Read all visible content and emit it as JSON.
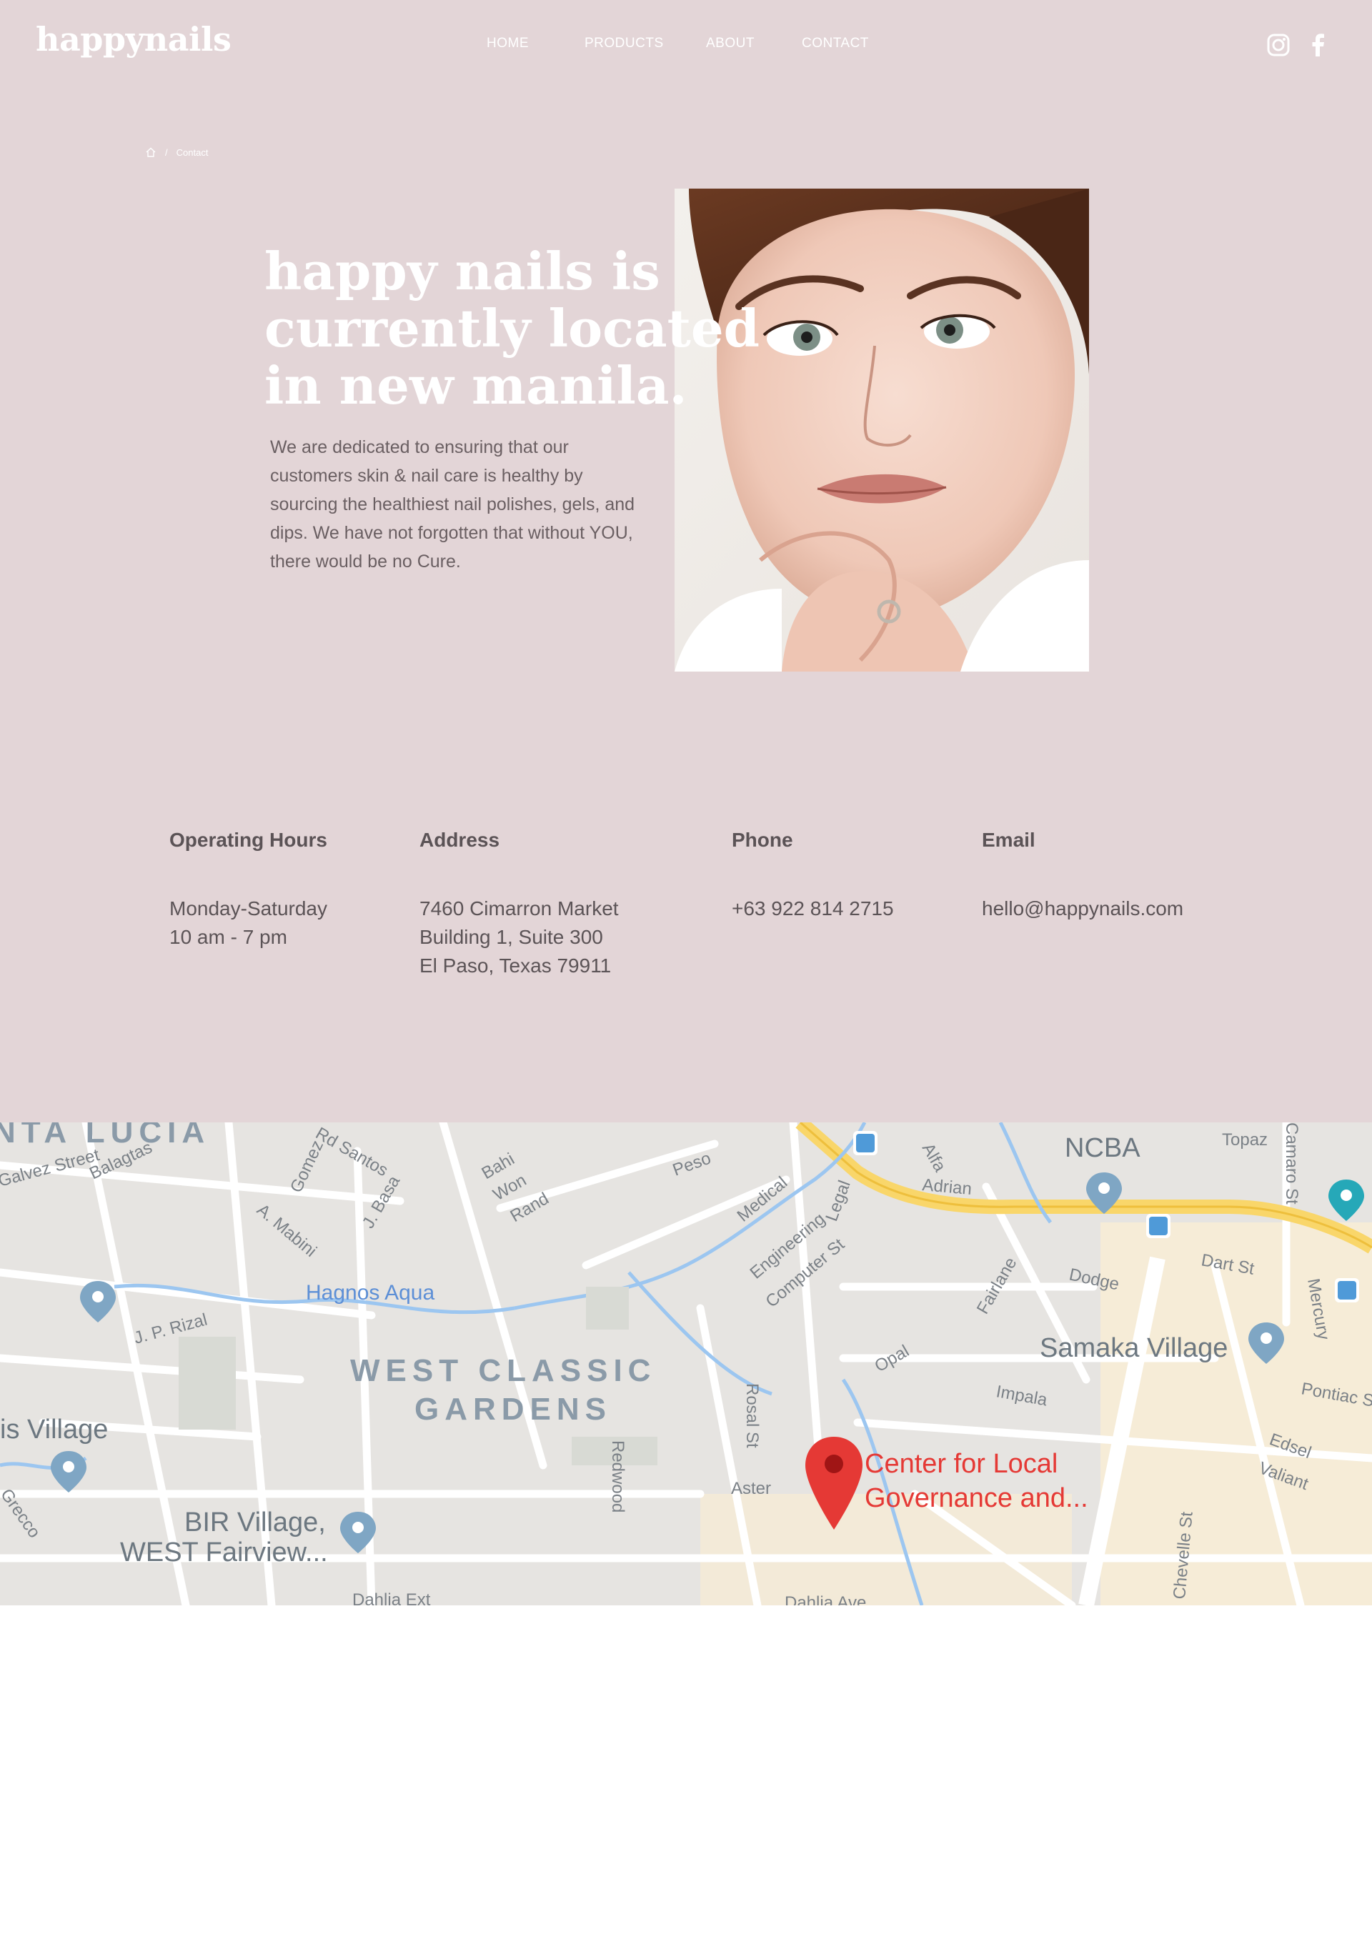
{
  "brand": {
    "logo": "happynails"
  },
  "nav": {
    "items": [
      "HOME",
      "PRODUCTS",
      "ABOUT",
      "CONTACT"
    ]
  },
  "social": {
    "icons": [
      "instagram-icon",
      "facebook-icon"
    ]
  },
  "breadcrumb": {
    "current": "Contact",
    "separator": "/"
  },
  "hero": {
    "title_lines": [
      "happy nails is",
      "currently located",
      "in new manila."
    ],
    "body": "We are dedicated to ensuring that our customers skin & nail care is healthy by sourcing the healthiest nail polishes, gels, and dips. We have not forgotten that without YOU, there would be no Cure."
  },
  "info": {
    "hours": {
      "heading": "Operating Hours",
      "lines": [
        "Monday-Saturday",
        "10 am - 7 pm"
      ]
    },
    "address": {
      "heading": "Address",
      "lines": [
        "7460 Cimarron Market",
        "Building 1, Suite 300",
        "El Paso, Texas 79911"
      ]
    },
    "phone": {
      "heading": "Phone",
      "lines": [
        "+63 922 814 2715"
      ]
    },
    "email": {
      "heading": "Email",
      "lines": [
        "hello@happynails.com"
      ]
    }
  },
  "map": {
    "pin_label_lines": [
      "Center for Local",
      "Governance and..."
    ],
    "areas": [
      "WEST CLASSIC",
      "GARDENS",
      "NTA LUCIA",
      "Samaka Village",
      "NCBA",
      "is Village",
      "BIR Village,",
      "WEST Fairview...",
      "Hagnos Aqua"
    ],
    "streets": [
      "Galvez Street",
      "Balagtas",
      "A. Mabini",
      "J. Basa",
      "Gomez",
      "Bahi",
      "Won",
      "Rand",
      "Peso",
      "Medical",
      "Engineering",
      "Computer St",
      "Legal",
      "Alfa",
      "Adrian",
      "Topaz",
      "Camaro St",
      "Dart St",
      "Mercury",
      "Pontiac St",
      "Dodge",
      "Fairlane",
      "Opal",
      "Impala",
      "Rosal St",
      "Aster",
      "Redwood",
      "Edsel",
      "Valiant",
      "Chevelle St",
      "J. P. Rizal",
      "Grecco",
      "Dahlia Ext",
      "Dahlia Ave",
      "Rd Santos"
    ]
  },
  "colors": {
    "background": "#e3d5d7",
    "text": "#5b5356",
    "accent": "#ffffff",
    "pin": "#e53935"
  }
}
